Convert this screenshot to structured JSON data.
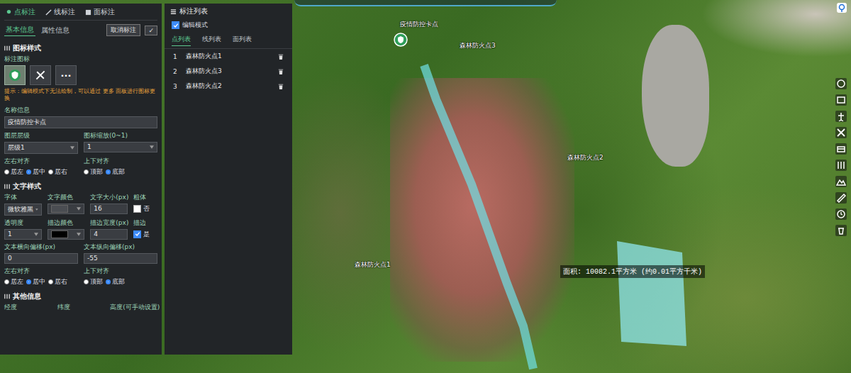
{
  "editor_panel": {
    "draw_tabs": [
      {
        "label": "点标注",
        "selected": true
      },
      {
        "label": "线标注",
        "selected": false
      },
      {
        "label": "面标注",
        "selected": false
      }
    ],
    "sub_tabs": [
      {
        "label": "基本信息",
        "selected": true
      },
      {
        "label": "属性信息",
        "selected": false
      }
    ],
    "cancel_button": "取消标注",
    "confirm_icon": "✓",
    "sections": [
      {
        "title": "图标样式",
        "rows": [
          [
            {
              "label": "标注图标",
              "kind": "icons",
              "buttons": [
                {
                  "kind": "shield",
                  "selected": true
                },
                {
                  "kind": "tools",
                  "selected": false
                },
                {
                  "kind": "more",
                  "text": "···",
                  "selected": false
                }
              ]
            }
          ],
          [
            {
              "kind": "hint",
              "text": "提示：编辑模式下无法绘制，可以通过 更多 面板进行图标更换"
            }
          ],
          [
            {
              "label": "名称信息",
              "kind": "input",
              "value": "疫情防控卡点"
            }
          ],
          [
            {
              "label": "图层层级",
              "kind": "select",
              "value": "层级1"
            },
            {
              "label": "图标缩放(0~1)",
              "kind": "select",
              "value": "1"
            }
          ],
          [
            {
              "label": "左右对齐",
              "kind": "radio",
              "options": [
                {
                  "label": "居左",
                  "selected": false
                },
                {
                  "label": "居中",
                  "selected": true
                },
                {
                  "label": "居右",
                  "selected": false
                }
              ]
            },
            {
              "label": "上下对齐",
              "kind": "radio",
              "options": [
                {
                  "label": "顶部",
                  "selected": false
                },
                {
                  "label": "底部",
                  "selected": true
                }
              ]
            }
          ]
        ]
      },
      {
        "title": "文字样式",
        "rows": [
          [
            {
              "label": "字体",
              "kind": "select",
              "value": "微软雅黑"
            },
            {
              "label": "文字颜色",
              "kind": "color",
              "color": "#4a4d52"
            },
            {
              "label": "文字大小(px)",
              "kind": "input",
              "value": "16"
            },
            {
              "label": "粗体",
              "kind": "checkbox",
              "checked": false,
              "text": "否"
            }
          ],
          [
            {
              "label": "透明度",
              "kind": "select",
              "value": "1"
            },
            {
              "label": "描边颜色",
              "kind": "color",
              "color": "#000000"
            },
            {
              "label": "描边宽度(px)",
              "kind": "input",
              "value": "4"
            },
            {
              "label": "描边",
              "kind": "checkbox",
              "checked": true,
              "text": "是"
            }
          ],
          [
            {
              "label": "文本横向偏移(px)",
              "kind": "input",
              "value": "0"
            },
            {
              "label": "文本纵向偏移(px)",
              "kind": "input",
              "value": "-55"
            }
          ],
          [
            {
              "label": "左右对齐",
              "kind": "radio",
              "options": [
                {
                  "label": "居左",
                  "selected": false
                },
                {
                  "label": "居中",
                  "selected": true
                },
                {
                  "label": "居右",
                  "selected": false
                }
              ]
            },
            {
              "label": "上下对齐",
              "kind": "radio",
              "options": [
                {
                  "label": "顶部",
                  "selected": false
                },
                {
                  "label": "底部",
                  "selected": true
                }
              ]
            }
          ]
        ]
      },
      {
        "title": "其他信息",
        "rows": [
          [
            {
              "label": "经度",
              "kind": "label"
            },
            {
              "label": "纬度",
              "kind": "label"
            },
            {
              "label": "高度(可手动设置)",
              "kind": "label"
            }
          ]
        ]
      }
    ]
  },
  "list_panel": {
    "title": "标注列表",
    "edit_mode": {
      "label": "编辑模式",
      "checked": true
    },
    "tabs": [
      {
        "label": "点列表",
        "selected": true
      },
      {
        "label": "线列表",
        "selected": false
      },
      {
        "label": "面列表",
        "selected": false
      }
    ],
    "items": [
      {
        "index": "1",
        "name": "森林防火点1"
      },
      {
        "index": "2",
        "name": "森林防火点3"
      },
      {
        "index": "3",
        "name": "森林防火点2"
      }
    ]
  },
  "map": {
    "labels": [
      "疫情防控卡点",
      "森林防火点3",
      "森林防火点2",
      "森林防火点1"
    ],
    "measure_tooltip": "面积: 10082.1平方米 (约0.01平方千米)"
  }
}
